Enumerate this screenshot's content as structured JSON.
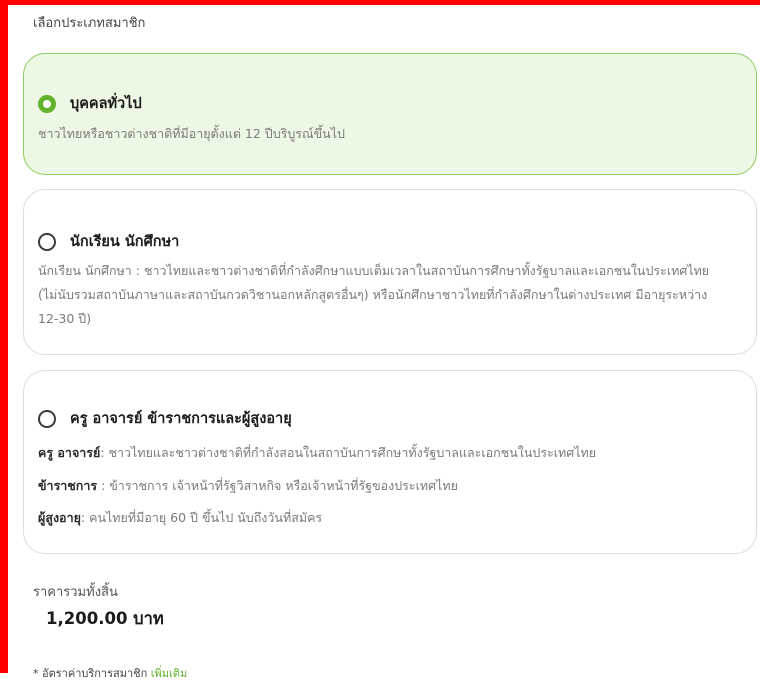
{
  "section_label": "เลือกประเภทสมาชิก",
  "options": [
    {
      "title": "บุคคลทั่วไป",
      "selected": true,
      "description": "ชาวไทยหรือชาวต่างชาติที่มีอายุตั้งแต่ 12 ปีบริบูรณ์ขึ้นไป"
    },
    {
      "title": "นักเรียน นักศึกษา",
      "selected": false,
      "description": "นักเรียน นักศึกษา : ชาวไทยและชาวต่างชาติที่กำลังศึกษาแบบเต็มเวลาในสถาบันการศึกษาทั้งรัฐบาลและเอกชนในประเทศไทย (ไม่นับรวมสถาบันภาษาและสถาบันกวดวิชานอกหลักสูตรอื่นๆ) หรือนักศึกษาชาวไทยที่กำลังศึกษาในต่างประเทศ มีอายุระหว่าง 12-30 ปี)"
    },
    {
      "title": "ครู อาจารย์ ข้าราชการและผู้สูงอายุ",
      "selected": false,
      "lines": [
        {
          "term": "ครู อาจารย์",
          "text": ": ชาวไทยและชาวต่างชาติที่กำลังสอนในสถาบันการศึกษาทั้งรัฐบาลและเอกชนในประเทศไทย"
        },
        {
          "term": "ข้าราชการ",
          "text": " : ข้าราชการ เจ้าหน้าที่รัฐวิสาหกิจ หรือเจ้าหน้าที่รัฐของประเทศไทย"
        },
        {
          "term": "ผู้สูงอายุ",
          "text": ": คนไทยที่มีอายุ 60 ปี ขึ้นไป นับถึงวันที่สมัคร"
        }
      ]
    }
  ],
  "total": {
    "label": "ราคารวมทั้งสิ้น",
    "value": "1,200.00 บาท"
  },
  "footnote": {
    "text": "* อัตราค่าบริการสมาชิก",
    "link": "เพิ่มเติม"
  },
  "colors": {
    "accent": "#63b22d",
    "selected_bg": "#edf8e4",
    "selected_border": "#8ccd5f",
    "annotation_red": "#ff0000"
  }
}
